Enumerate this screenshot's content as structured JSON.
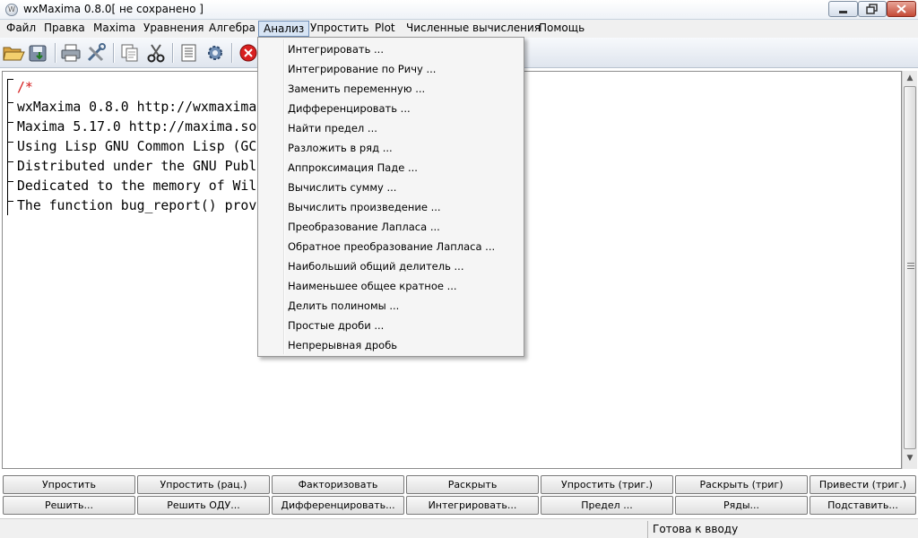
{
  "window": {
    "title": "wxMaxima 0.8.0[ не сохранено ]",
    "minimize": "0",
    "maximize": "1",
    "close": "r"
  },
  "menubar": {
    "items": [
      "Файл",
      "Правка",
      "Maxima",
      "Уравнения",
      "Алгебра",
      "Анализ",
      "Упростить",
      "Plot",
      "Численные вычисления",
      "Помощь"
    ],
    "active": "Анализ"
  },
  "toolbar": {
    "icons": [
      "open-icon",
      "save-icon",
      "print-icon",
      "preferences-icon",
      "copy-icon",
      "cut-icon",
      "select-all-icon",
      "settings-icon",
      "interrupt-icon"
    ]
  },
  "document": {
    "lines": [
      "/*",
      "wxMaxima 0.8.0 http://wxmaxima.sourceforge.net",
      "Maxima 5.17.0 http://maxima.sourceforge.net",
      "Using Lisp GNU Common Lisp (GCL) GCL 2.6.8 (aka GCL)",
      "Distributed under the GNU Public License. See the file COPYING.",
      "Dedicated to the memory of William Schelter.",
      "The function bug_report() provides bug reporting information."
    ]
  },
  "dropdown": {
    "items": [
      "Интегрировать ...",
      "Интегрирование по Ричу ...",
      "Заменить переменную ...",
      "Дифференцировать ...",
      "Найти предел ...",
      "Разложить в ряд ...",
      "Аппроксимация Паде ...",
      "Вычислить сумму ...",
      "Вычислить произведение ...",
      "Преобразование Лапласа ...",
      "Обратное преобразование Лапласа ...",
      "Наибольший общий делитель ...",
      "Наименьшее общее кратное ...",
      "Делить полиномы ...",
      "Простые дроби ...",
      "Непрерывная дробь"
    ]
  },
  "buttons": {
    "row1": [
      "Упростить",
      "Упростить (рац.)",
      "Факторизовать",
      "Раскрыть",
      "Упростить (триг.)",
      "Раскрыть (триг)",
      "Привести (триг.)"
    ],
    "row2": [
      "Решить...",
      "Решить ОДУ...",
      "Дифференцировать...",
      "Интегрировать...",
      "Предел ...",
      "Ряды...",
      "Подставить..."
    ]
  },
  "status": {
    "text": "Готова к вводу"
  },
  "colors": {
    "comment": "#d41b1b",
    "menu_active_bg": "#d7e4f4",
    "menu_active_border": "#6f8fb8",
    "close_button": "#c44a36"
  }
}
